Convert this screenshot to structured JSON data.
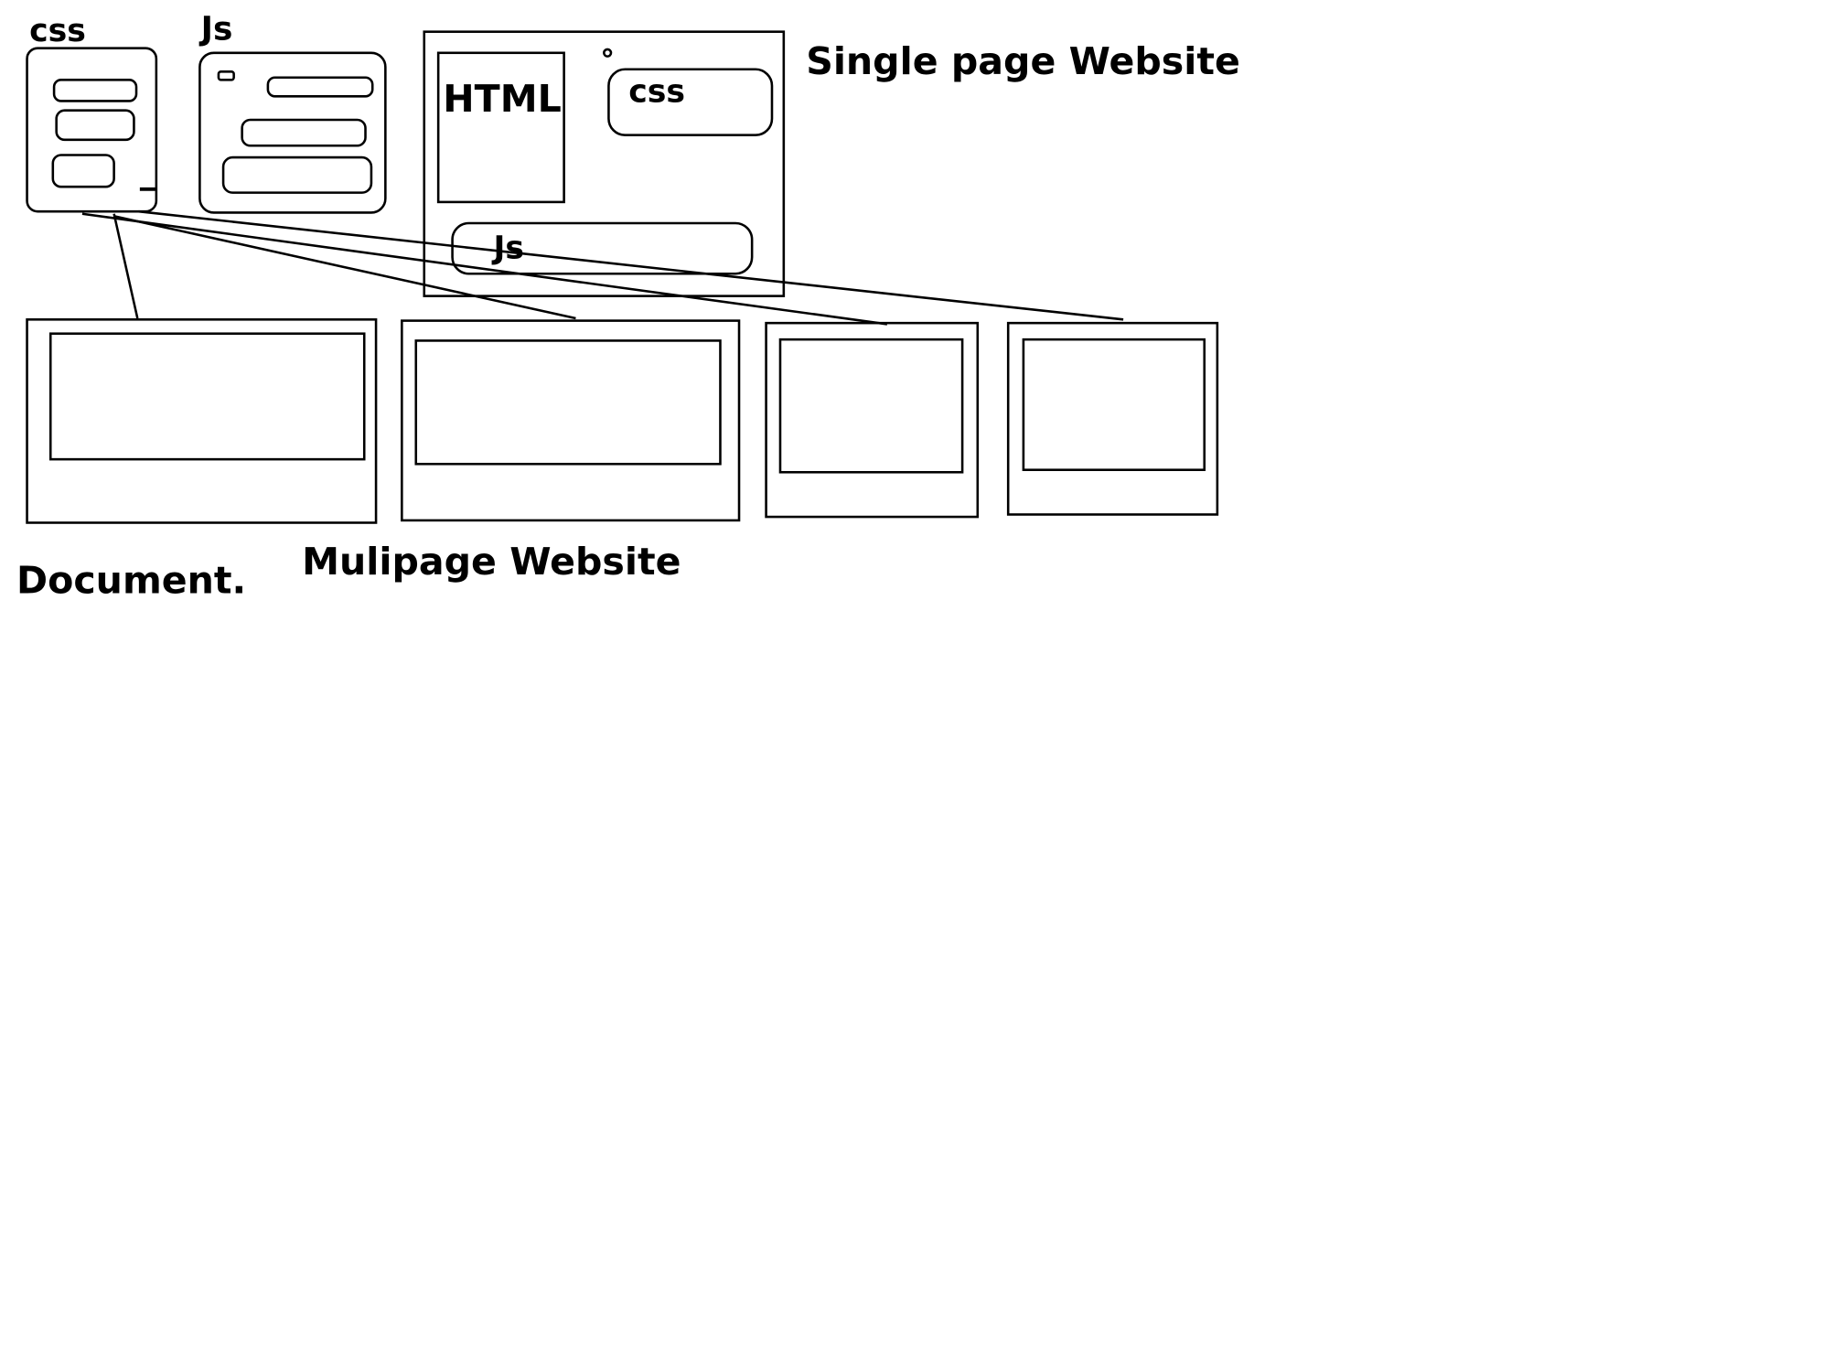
{
  "labels": {
    "css_small": "css",
    "js_small": "Js",
    "html": "HTML",
    "css_spa": "css",
    "js_spa": "Js",
    "single_page": "Single page Website",
    "document": "Document.",
    "multipage": "Mulipage Website"
  },
  "colors": {
    "stroke": "#000000",
    "background": "#ffffff"
  }
}
